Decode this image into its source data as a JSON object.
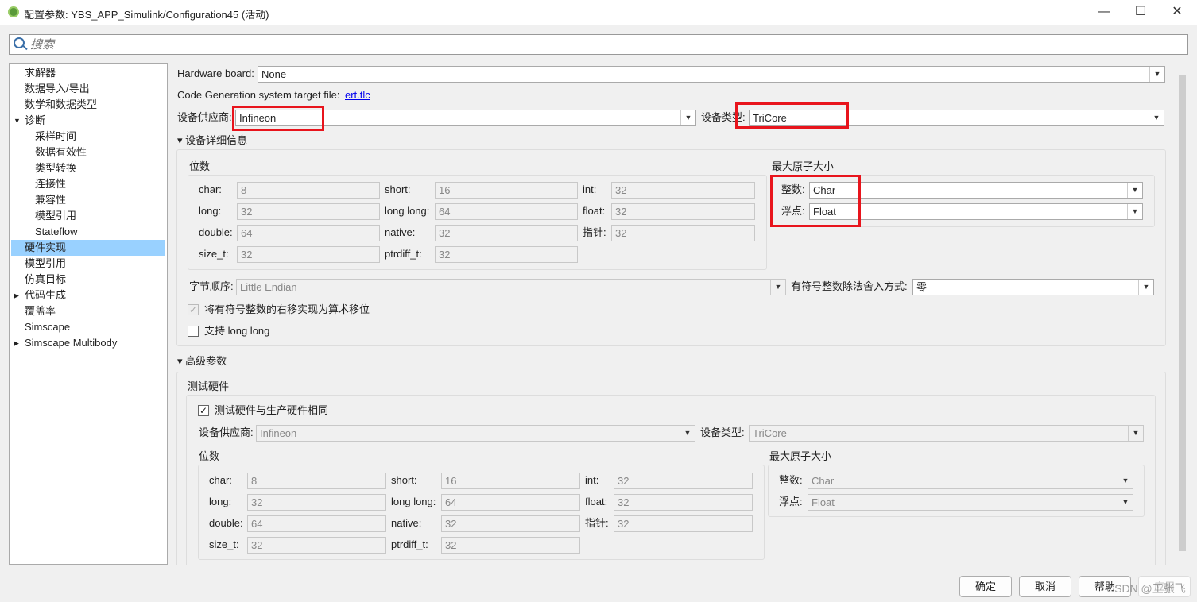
{
  "window": {
    "title": "配置参数: YBS_APP_Simulink/Configuration45 (活动)",
    "icon": "gear-icon",
    "minimize": "—",
    "maximize": "☐",
    "close": "✕"
  },
  "search": {
    "placeholder": "搜索"
  },
  "tree": [
    {
      "label": "求解器",
      "level": 0
    },
    {
      "label": "数据导入/导出",
      "level": 0
    },
    {
      "label": "数学和数据类型",
      "level": 0
    },
    {
      "label": "诊断",
      "level": 0,
      "expanded": true
    },
    {
      "label": "采样时间",
      "level": 1
    },
    {
      "label": "数据有效性",
      "level": 1
    },
    {
      "label": "类型转换",
      "level": 1
    },
    {
      "label": "连接性",
      "level": 1
    },
    {
      "label": "兼容性",
      "level": 1
    },
    {
      "label": "模型引用",
      "level": 1
    },
    {
      "label": "Stateflow",
      "level": 1
    },
    {
      "label": "硬件实现",
      "level": 0,
      "selected": true
    },
    {
      "label": "模型引用",
      "level": 0
    },
    {
      "label": "仿真目标",
      "level": 0
    },
    {
      "label": "代码生成",
      "level": 0,
      "collapsed": true
    },
    {
      "label": "覆盖率",
      "level": 0
    },
    {
      "label": "Simscape",
      "level": 0
    },
    {
      "label": "Simscape Multibody",
      "level": 0,
      "collapsed": true
    }
  ],
  "main": {
    "hw_board_label": "Hardware board:",
    "hw_board_value": "None",
    "target_file_label": "Code Generation system target file:",
    "target_file_link": "ert.tlc",
    "vendor_label": "设备供应商:",
    "vendor_value": "Infineon",
    "type_label": "设备类型:",
    "type_value": "TriCore",
    "details": {
      "title": "设备详细信息",
      "bits_title": "位数",
      "bits": [
        [
          "char:",
          "8",
          "short:",
          "16",
          "int:",
          "32"
        ],
        [
          "long:",
          "32",
          "long long:",
          "64",
          "float:",
          "32"
        ],
        [
          "double:",
          "64",
          "native:",
          "32",
          "指针:",
          "32"
        ],
        [
          "size_t:",
          "32",
          "ptrdiff_t:",
          "32"
        ]
      ],
      "atomic_title": "最大原子大小",
      "int_label": "整数:",
      "int_value": "Char",
      "float_label": "浮点:",
      "float_value": "Float",
      "byte_order_label": "字节顺序:",
      "byte_order_value": "Little Endian",
      "rounding_label": "有符号整数除法舍入方式:",
      "rounding_value": "零",
      "shift_label": "将有符号整数的右移实现为算术移位",
      "shift_checked": true,
      "longlong_label": "支持 long long",
      "longlong_checked": false
    },
    "advanced": {
      "title": "高级参数",
      "test_hw_title": "测试硬件",
      "same_label": "测试硬件与生产硬件相同",
      "same_checked": true,
      "vendor_label": "设备供应商:",
      "vendor_value": "Infineon",
      "type_label": "设备类型:",
      "type_value": "TriCore",
      "bits_title": "位数",
      "bits": [
        [
          "char:",
          "8",
          "short:",
          "16",
          "int:",
          "32"
        ],
        [
          "long:",
          "32",
          "long long:",
          "64",
          "float:",
          "32"
        ],
        [
          "double:",
          "64",
          "native:",
          "32",
          "指针:",
          "32"
        ],
        [
          "size_t:",
          "32",
          "ptrdiff_t:",
          "32"
        ]
      ],
      "atomic_title": "最大原子大小",
      "int_label": "整数:",
      "int_value": "Char",
      "float_label": "浮点:",
      "float_value": "Float"
    }
  },
  "buttons": {
    "ok": "确定",
    "cancel": "取消",
    "help": "帮助",
    "apply": "应用"
  },
  "watermark": "CSDN @王张飞",
  "colors": {
    "highlight": "#e8141c",
    "selected": "#99d1ff"
  }
}
